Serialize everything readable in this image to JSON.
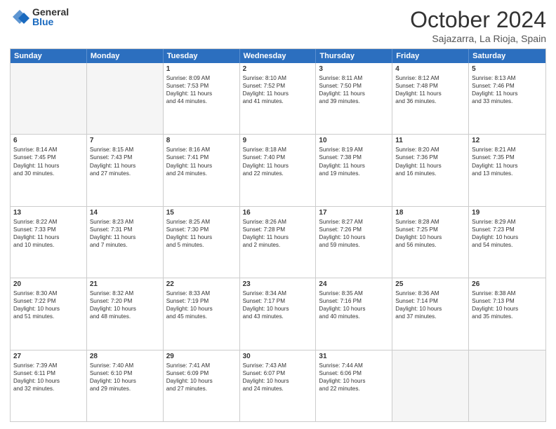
{
  "logo": {
    "general": "General",
    "blue": "Blue"
  },
  "title": "October 2024",
  "subtitle": "Sajazarra, La Rioja, Spain",
  "header_days": [
    "Sunday",
    "Monday",
    "Tuesday",
    "Wednesday",
    "Thursday",
    "Friday",
    "Saturday"
  ],
  "weeks": [
    [
      {
        "day": "",
        "lines": [],
        "empty": true
      },
      {
        "day": "",
        "lines": [],
        "empty": true
      },
      {
        "day": "1",
        "lines": [
          "Sunrise: 8:09 AM",
          "Sunset: 7:53 PM",
          "Daylight: 11 hours",
          "and 44 minutes."
        ],
        "empty": false
      },
      {
        "day": "2",
        "lines": [
          "Sunrise: 8:10 AM",
          "Sunset: 7:52 PM",
          "Daylight: 11 hours",
          "and 41 minutes."
        ],
        "empty": false
      },
      {
        "day": "3",
        "lines": [
          "Sunrise: 8:11 AM",
          "Sunset: 7:50 PM",
          "Daylight: 11 hours",
          "and 39 minutes."
        ],
        "empty": false
      },
      {
        "day": "4",
        "lines": [
          "Sunrise: 8:12 AM",
          "Sunset: 7:48 PM",
          "Daylight: 11 hours",
          "and 36 minutes."
        ],
        "empty": false
      },
      {
        "day": "5",
        "lines": [
          "Sunrise: 8:13 AM",
          "Sunset: 7:46 PM",
          "Daylight: 11 hours",
          "and 33 minutes."
        ],
        "empty": false
      }
    ],
    [
      {
        "day": "6",
        "lines": [
          "Sunrise: 8:14 AM",
          "Sunset: 7:45 PM",
          "Daylight: 11 hours",
          "and 30 minutes."
        ],
        "empty": false
      },
      {
        "day": "7",
        "lines": [
          "Sunrise: 8:15 AM",
          "Sunset: 7:43 PM",
          "Daylight: 11 hours",
          "and 27 minutes."
        ],
        "empty": false
      },
      {
        "day": "8",
        "lines": [
          "Sunrise: 8:16 AM",
          "Sunset: 7:41 PM",
          "Daylight: 11 hours",
          "and 24 minutes."
        ],
        "empty": false
      },
      {
        "day": "9",
        "lines": [
          "Sunrise: 8:18 AM",
          "Sunset: 7:40 PM",
          "Daylight: 11 hours",
          "and 22 minutes."
        ],
        "empty": false
      },
      {
        "day": "10",
        "lines": [
          "Sunrise: 8:19 AM",
          "Sunset: 7:38 PM",
          "Daylight: 11 hours",
          "and 19 minutes."
        ],
        "empty": false
      },
      {
        "day": "11",
        "lines": [
          "Sunrise: 8:20 AM",
          "Sunset: 7:36 PM",
          "Daylight: 11 hours",
          "and 16 minutes."
        ],
        "empty": false
      },
      {
        "day": "12",
        "lines": [
          "Sunrise: 8:21 AM",
          "Sunset: 7:35 PM",
          "Daylight: 11 hours",
          "and 13 minutes."
        ],
        "empty": false
      }
    ],
    [
      {
        "day": "13",
        "lines": [
          "Sunrise: 8:22 AM",
          "Sunset: 7:33 PM",
          "Daylight: 11 hours",
          "and 10 minutes."
        ],
        "empty": false
      },
      {
        "day": "14",
        "lines": [
          "Sunrise: 8:23 AM",
          "Sunset: 7:31 PM",
          "Daylight: 11 hours",
          "and 7 minutes."
        ],
        "empty": false
      },
      {
        "day": "15",
        "lines": [
          "Sunrise: 8:25 AM",
          "Sunset: 7:30 PM",
          "Daylight: 11 hours",
          "and 5 minutes."
        ],
        "empty": false
      },
      {
        "day": "16",
        "lines": [
          "Sunrise: 8:26 AM",
          "Sunset: 7:28 PM",
          "Daylight: 11 hours",
          "and 2 minutes."
        ],
        "empty": false
      },
      {
        "day": "17",
        "lines": [
          "Sunrise: 8:27 AM",
          "Sunset: 7:26 PM",
          "Daylight: 10 hours",
          "and 59 minutes."
        ],
        "empty": false
      },
      {
        "day": "18",
        "lines": [
          "Sunrise: 8:28 AM",
          "Sunset: 7:25 PM",
          "Daylight: 10 hours",
          "and 56 minutes."
        ],
        "empty": false
      },
      {
        "day": "19",
        "lines": [
          "Sunrise: 8:29 AM",
          "Sunset: 7:23 PM",
          "Daylight: 10 hours",
          "and 54 minutes."
        ],
        "empty": false
      }
    ],
    [
      {
        "day": "20",
        "lines": [
          "Sunrise: 8:30 AM",
          "Sunset: 7:22 PM",
          "Daylight: 10 hours",
          "and 51 minutes."
        ],
        "empty": false
      },
      {
        "day": "21",
        "lines": [
          "Sunrise: 8:32 AM",
          "Sunset: 7:20 PM",
          "Daylight: 10 hours",
          "and 48 minutes."
        ],
        "empty": false
      },
      {
        "day": "22",
        "lines": [
          "Sunrise: 8:33 AM",
          "Sunset: 7:19 PM",
          "Daylight: 10 hours",
          "and 45 minutes."
        ],
        "empty": false
      },
      {
        "day": "23",
        "lines": [
          "Sunrise: 8:34 AM",
          "Sunset: 7:17 PM",
          "Daylight: 10 hours",
          "and 43 minutes."
        ],
        "empty": false
      },
      {
        "day": "24",
        "lines": [
          "Sunrise: 8:35 AM",
          "Sunset: 7:16 PM",
          "Daylight: 10 hours",
          "and 40 minutes."
        ],
        "empty": false
      },
      {
        "day": "25",
        "lines": [
          "Sunrise: 8:36 AM",
          "Sunset: 7:14 PM",
          "Daylight: 10 hours",
          "and 37 minutes."
        ],
        "empty": false
      },
      {
        "day": "26",
        "lines": [
          "Sunrise: 8:38 AM",
          "Sunset: 7:13 PM",
          "Daylight: 10 hours",
          "and 35 minutes."
        ],
        "empty": false
      }
    ],
    [
      {
        "day": "27",
        "lines": [
          "Sunrise: 7:39 AM",
          "Sunset: 6:11 PM",
          "Daylight: 10 hours",
          "and 32 minutes."
        ],
        "empty": false
      },
      {
        "day": "28",
        "lines": [
          "Sunrise: 7:40 AM",
          "Sunset: 6:10 PM",
          "Daylight: 10 hours",
          "and 29 minutes."
        ],
        "empty": false
      },
      {
        "day": "29",
        "lines": [
          "Sunrise: 7:41 AM",
          "Sunset: 6:09 PM",
          "Daylight: 10 hours",
          "and 27 minutes."
        ],
        "empty": false
      },
      {
        "day": "30",
        "lines": [
          "Sunrise: 7:43 AM",
          "Sunset: 6:07 PM",
          "Daylight: 10 hours",
          "and 24 minutes."
        ],
        "empty": false
      },
      {
        "day": "31",
        "lines": [
          "Sunrise: 7:44 AM",
          "Sunset: 6:06 PM",
          "Daylight: 10 hours",
          "and 22 minutes."
        ],
        "empty": false
      },
      {
        "day": "",
        "lines": [],
        "empty": true
      },
      {
        "day": "",
        "lines": [],
        "empty": true
      }
    ]
  ]
}
